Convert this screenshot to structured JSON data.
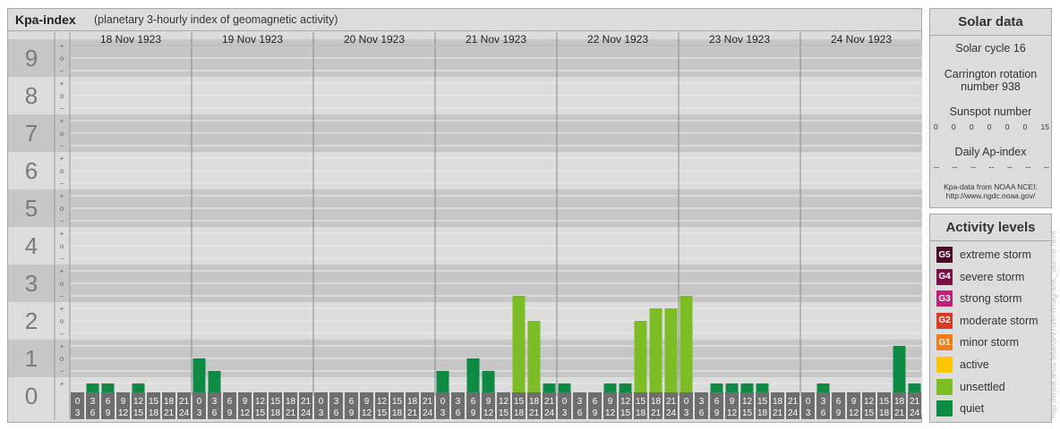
{
  "title": {
    "main": "Kpa-index",
    "sub": "(planetary 3-hourly index of geomagnetic activity)"
  },
  "chart_data": {
    "type": "bar",
    "days": [
      "18 Nov 1923",
      "19 Nov 1923",
      "20 Nov 1923",
      "21 Nov 1923",
      "22 Nov 1923",
      "23 Nov 1923",
      "24 Nov 1923"
    ],
    "interval_labels": [
      [
        "0",
        "3"
      ],
      [
        "3",
        "6"
      ],
      [
        "6",
        "9"
      ],
      [
        "9",
        "12"
      ],
      [
        "12",
        "15"
      ],
      [
        "15",
        "18"
      ],
      [
        "18",
        "21"
      ],
      [
        "21",
        "24"
      ]
    ],
    "values": [
      [
        0,
        0.333,
        0.333,
        0,
        0.333,
        0,
        0,
        0
      ],
      [
        1.0,
        0.667,
        0,
        0,
        0,
        0,
        0,
        0
      ],
      [
        0,
        0,
        0,
        0,
        0,
        0,
        0,
        0
      ],
      [
        0.667,
        0,
        1.0,
        0.667,
        0,
        2.667,
        2.0,
        0.333
      ],
      [
        0.333,
        0,
        0,
        0.333,
        0.333,
        2.0,
        2.333,
        2.333
      ],
      [
        2.667,
        0,
        0.333,
        0.333,
        0.333,
        0.333,
        0,
        0
      ],
      [
        0,
        0.333,
        0,
        0,
        0,
        0,
        1.333,
        0.333
      ]
    ],
    "ylim": [
      0,
      9
    ],
    "y_ticks": [
      "0",
      "1",
      "2",
      "3",
      "4",
      "5",
      "6",
      "7",
      "8",
      "9"
    ],
    "minor_ticks": [
      "o",
      "+",
      "−"
    ],
    "colors": {
      "quiet": "#0d8b45",
      "unsettled": "#7cbd25",
      "active": "#f9c500",
      "label_bg": "#6e6e6e",
      "band_dark": "#c6c6c6",
      "band_light": "#dcdcdc"
    }
  },
  "solar": {
    "title": "Solar data",
    "cycle": "Solar cycle 16",
    "carrington_line1": "Carrington rotation",
    "carrington_line2": "number 938",
    "sunspot_label": "Sunspot number",
    "sunspot_values": [
      "0",
      "0",
      "0",
      "0",
      "0",
      "0",
      "15"
    ],
    "ap_label": "Daily Ap-index",
    "ap_values": [
      "--",
      "--",
      "--",
      "--",
      "--",
      "--",
      "--"
    ],
    "source_line1": "Kpa-data from NOAA NCEI:",
    "source_line2": "http://www.ngdc.noaa.gov/"
  },
  "activity": {
    "title": "Activity levels",
    "items": [
      {
        "code": "G5",
        "label": "extreme storm",
        "color": "#4a0a28"
      },
      {
        "code": "G4",
        "label": "severe storm",
        "color": "#7a1048"
      },
      {
        "code": "G3",
        "label": "strong storm",
        "color": "#c0207a"
      },
      {
        "code": "G2",
        "label": "moderate storm",
        "color": "#d83a24"
      },
      {
        "code": "G1",
        "label": "minor storm",
        "color": "#ee7d1a"
      },
      {
        "code": "",
        "label": "active",
        "color": "#f9c500"
      },
      {
        "code": "",
        "label": "unsettled",
        "color": "#7cbd25"
      },
      {
        "code": "",
        "label": "quiet",
        "color": "#0d8b45"
      }
    ]
  },
  "watermark": "http://www.tesis.lebedev.ru/en/magnetic_storms.html"
}
